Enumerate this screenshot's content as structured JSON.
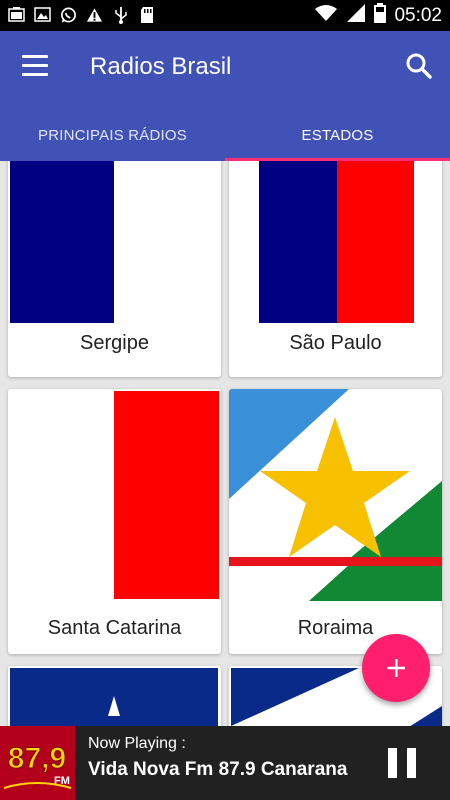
{
  "status_bar": {
    "time": "05:02",
    "icons": [
      "photo-icon",
      "image-icon",
      "whatsapp-icon",
      "warning-icon",
      "usb-icon",
      "sd-card-icon",
      "wifi-icon",
      "signal-icon",
      "battery-icon"
    ]
  },
  "app_bar": {
    "title": "Radios Brasil",
    "menu_icon": "hamburger-menu-icon",
    "search_icon": "search-icon",
    "color": "#4052b5"
  },
  "tabs": [
    {
      "label": "PRINCIPAIS RÁDIOS",
      "selected": false
    },
    {
      "label": "ESTADOS",
      "selected": true
    }
  ],
  "states": [
    {
      "name": "Sergipe"
    },
    {
      "name": "São Paulo"
    },
    {
      "name": "Santa Catarina"
    },
    {
      "name": "Roraima"
    }
  ],
  "fab": {
    "symbol": "+",
    "color": "#ff1f6c"
  },
  "player": {
    "now_playing_label": "Now Playing :",
    "station": "Vida Nova Fm 87.9 Canarana",
    "logo_text": "87,9",
    "logo_sub": "FM",
    "pause_icon": "pause-icon"
  },
  "colors": {
    "accent": "#ff2d75",
    "flag_blue": "#000080",
    "flag_red": "#ff0000",
    "roraima_green": "#118833",
    "roraima_sky": "#3a8fd9",
    "roraima_star": "#f7c000"
  }
}
